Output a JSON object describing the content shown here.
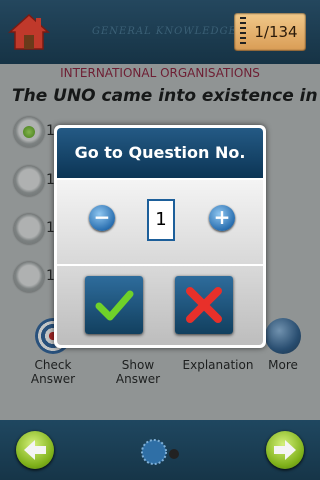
{
  "header": {
    "app_title": "General Knowledge",
    "counter": "1/134"
  },
  "quiz": {
    "category": "INTERNATIONAL ORGANISATIONS",
    "question": "The UNO came into existence in",
    "options": [
      {
        "text": "1",
        "selected": true
      },
      {
        "text": "1",
        "selected": false
      },
      {
        "text": "1",
        "selected": false
      },
      {
        "text": "1",
        "selected": false
      }
    ]
  },
  "toolbar": {
    "check_answer": "Check Answer",
    "show_answer": "Show Answer",
    "explanation": "Explanation",
    "more": "More"
  },
  "dialog": {
    "title": "Go to Question No.",
    "value": "1",
    "minus": "−",
    "plus": "+"
  },
  "colors": {
    "header_bg": "#1d3d52",
    "category_text": "#8a1a36",
    "dialog_header": "#1a4a72",
    "confirm_check": "#6fd12a",
    "cancel_x": "#e8302a",
    "nav_green": "#8fc12a"
  },
  "icons": {
    "home": "home-icon",
    "check_answer": "target-icon",
    "explanation": "info-icon",
    "more": "globe-icon",
    "confirm": "check-icon",
    "cancel": "x-icon",
    "back": "arrow-left-icon",
    "next": "arrow-right-icon",
    "bottom_center": "saw-icon"
  }
}
